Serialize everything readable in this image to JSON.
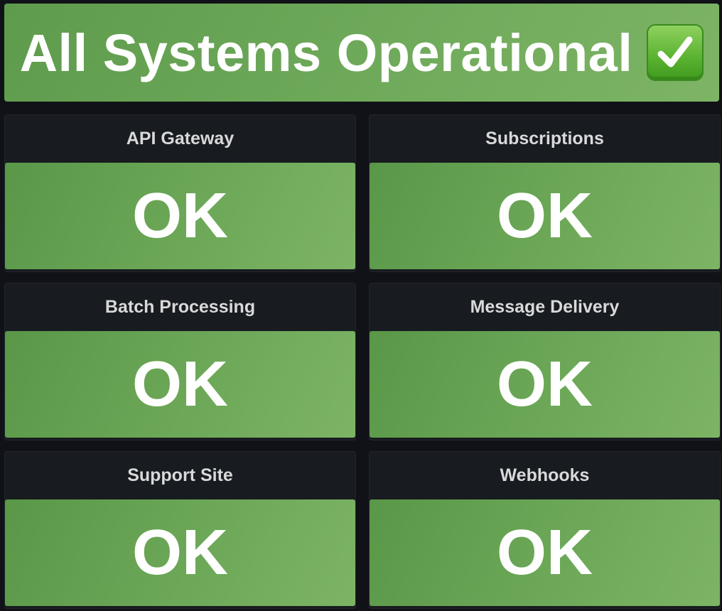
{
  "banner": {
    "text": "All Systems Operational",
    "icon": "check-mark-button-icon",
    "color": "#6ea95a"
  },
  "panels": [
    {
      "title": "API Gateway",
      "value": "OK"
    },
    {
      "title": "Subscriptions",
      "value": "OK"
    },
    {
      "title": "Batch Processing",
      "value": "OK"
    },
    {
      "title": "Message Delivery",
      "value": "OK"
    },
    {
      "title": "Support Site",
      "value": "OK"
    },
    {
      "title": "Webhooks",
      "value": "OK"
    }
  ],
  "colors": {
    "background": "#111217",
    "panel_background": "#181b1f",
    "status_ok": "#6ea95a",
    "title_text": "#d8d9da",
    "value_text": "#ffffff"
  }
}
